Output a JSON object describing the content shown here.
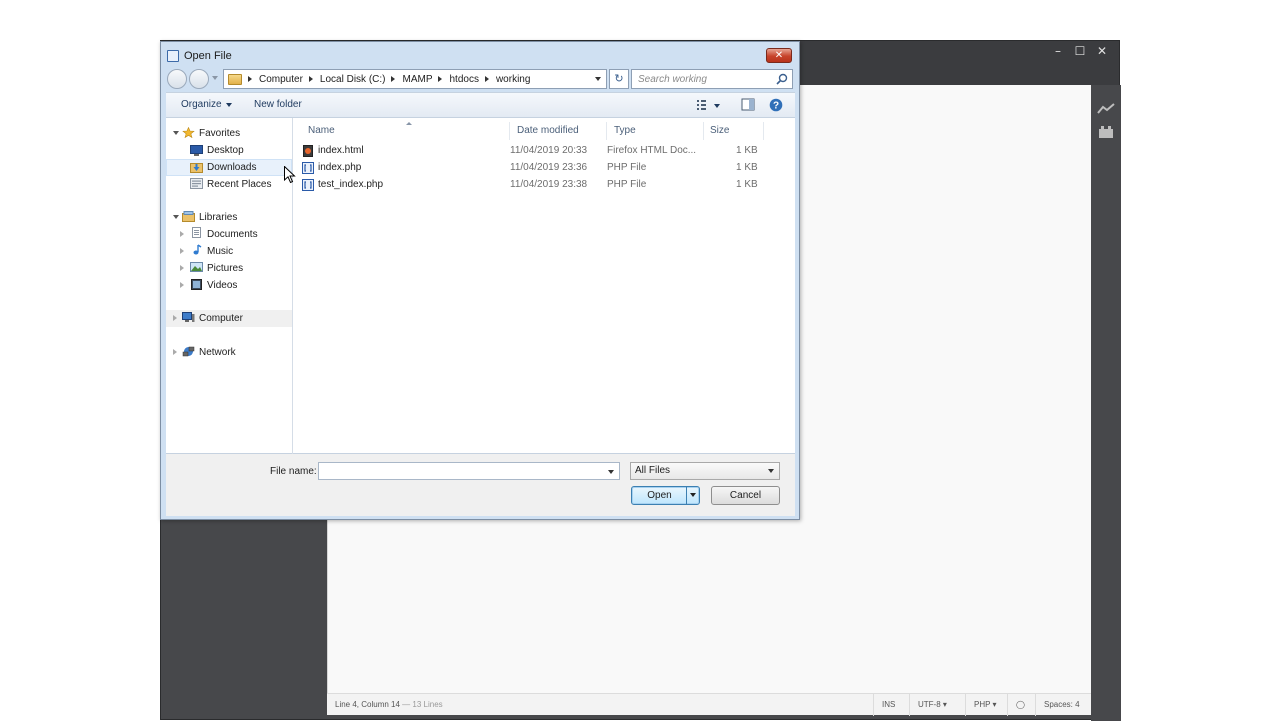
{
  "editor": {
    "status_position": "Line 4, Column 14",
    "status_lines": "13 Lines",
    "status_ins": "INS",
    "status_encoding": "UTF-8",
    "status_language": "PHP",
    "status_spaces": "Spaces: 4"
  },
  "dialog": {
    "title": "Open File",
    "close_label": "✕",
    "breadcrumb": [
      "Computer",
      "Local Disk (C:)",
      "MAMP",
      "htdocs",
      "working"
    ],
    "search_placeholder": "Search working",
    "toolbar": {
      "organize": "Organize",
      "new_folder": "New folder"
    },
    "nav": {
      "favorites": "Favorites",
      "desktop": "Desktop",
      "downloads": "Downloads",
      "recent_places": "Recent Places",
      "libraries": "Libraries",
      "documents": "Documents",
      "music": "Music",
      "pictures": "Pictures",
      "videos": "Videos",
      "computer": "Computer",
      "network": "Network"
    },
    "columns": {
      "name": "Name",
      "date_modified": "Date modified",
      "type": "Type",
      "size": "Size"
    },
    "files": [
      {
        "name": "index.html",
        "date": "11/04/2019 20:33",
        "type": "Firefox HTML Doc...",
        "size": "1 KB"
      },
      {
        "name": "index.php",
        "date": "11/04/2019 23:36",
        "type": "PHP File",
        "size": "1 KB"
      },
      {
        "name": "test_index.php",
        "date": "11/04/2019 23:38",
        "type": "PHP File",
        "size": "1 KB"
      }
    ],
    "file_name_label": "File name:",
    "file_name_value": "",
    "filter_value": "All Files",
    "open_label": "Open",
    "cancel_label": "Cancel"
  },
  "colors": {
    "accent": "#3c7fb1",
    "editor_bg": "#47484b",
    "dialog_frame": "#cfe0f2"
  }
}
